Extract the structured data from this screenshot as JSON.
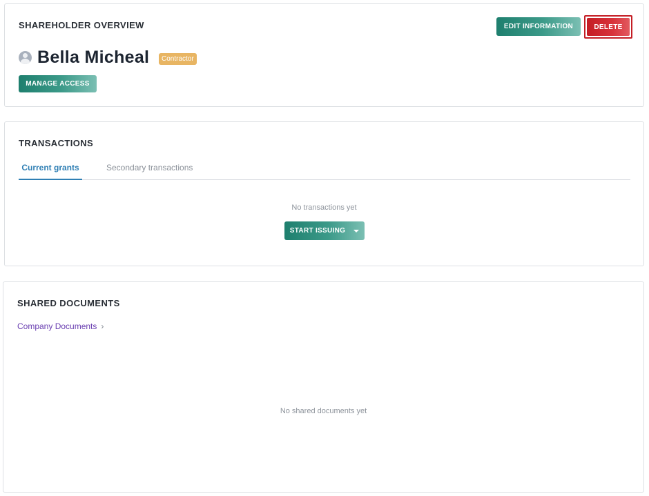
{
  "overview": {
    "title": "SHAREHOLDER OVERVIEW",
    "edit_label": "EDIT INFORMATION",
    "delete_label": "DELETE",
    "name": "Bella Micheal",
    "badge": "Contractor",
    "manage_label": "MANAGE ACCESS"
  },
  "transactions": {
    "title": "TRANSACTIONS",
    "tabs": [
      {
        "label": "Current grants",
        "active": true
      },
      {
        "label": "Secondary transactions",
        "active": false
      }
    ],
    "empty_text": "No transactions yet",
    "start_label": "START ISSUING"
  },
  "documents": {
    "title": "SHARED DOCUMENTS",
    "link_label": "Company Documents",
    "empty_text": "No shared documents yet"
  },
  "icons": {
    "avatar": "user-avatar-icon",
    "caret": "caret-down-icon",
    "chevron": "chevron-right-icon"
  },
  "colors": {
    "primary_teal": "#1e7f6e",
    "danger_red": "#c41d24",
    "badge_orange": "#e8b563",
    "tab_blue": "#2f7fb4",
    "link_purple": "#6a3fb1"
  }
}
